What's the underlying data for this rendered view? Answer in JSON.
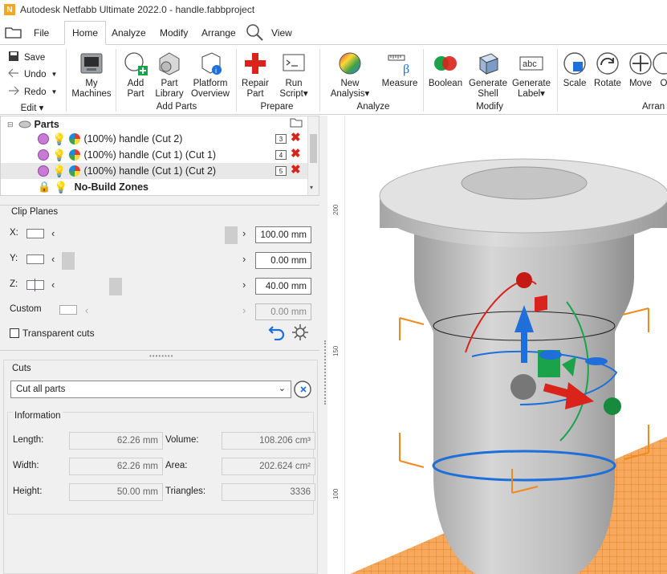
{
  "window": {
    "title": "Autodesk Netfabb Ultimate 2022.0 - handle.fabbproject",
    "app_icon": "N"
  },
  "tabs": [
    {
      "label": "File"
    },
    {
      "label": "Home"
    },
    {
      "label": "Analyze"
    },
    {
      "label": "Modify"
    },
    {
      "label": "Arrange"
    },
    {
      "label": "View"
    }
  ],
  "ribbon": {
    "edit": {
      "save": "Save",
      "undo": "Undo",
      "redo": "Redo",
      "group": "Edit"
    },
    "my_machines": [
      "My",
      "Machines"
    ],
    "add_parts": {
      "add_part": [
        "Add",
        "Part"
      ],
      "part_library": [
        "Part",
        "Library"
      ],
      "platform_overview": [
        "Platform",
        "Overview"
      ],
      "group": "Add Parts"
    },
    "prepare": {
      "repair_part": [
        "Repair",
        "Part"
      ],
      "run_script": [
        "Run",
        "Script"
      ],
      "group": "Prepare"
    },
    "analyze": {
      "new_analysis": [
        "New",
        "Analysis"
      ],
      "measure": "Measure",
      "group": "Analyze"
    },
    "modify": {
      "boolean": "Boolean",
      "generate_shell": [
        "Generate",
        "Shell"
      ],
      "generate_label": [
        "Generate",
        "Label"
      ],
      "group": "Modify"
    },
    "arrange": {
      "scale": "Scale",
      "rotate": "Rotate",
      "move": "Move",
      "more": "O",
      "group": "Arran"
    }
  },
  "tree": {
    "root": "Parts",
    "items": [
      {
        "label": "(100%) handle (Cut 2)",
        "badge": "3"
      },
      {
        "label": "(100%) handle (Cut 1) (Cut 1)",
        "badge": "4"
      },
      {
        "label": "(100%) handle (Cut 1) (Cut 2)",
        "badge": "5"
      }
    ],
    "no_build": "No-Build Zones"
  },
  "clip_planes": {
    "title": "Clip Planes",
    "x": {
      "label": "X:",
      "value": "100.00 mm"
    },
    "y": {
      "label": "Y:",
      "value": "0.00 mm"
    },
    "z": {
      "label": "Z:",
      "value": "40.00 mm"
    },
    "custom": {
      "label": "Custom",
      "value": "0.00 mm"
    },
    "transparent_label": "Transparent cuts"
  },
  "cuts": {
    "title": "Cuts",
    "selected": "Cut all parts"
  },
  "information": {
    "title": "Information",
    "length_label": "Length:",
    "length": "62.26 mm",
    "width_label": "Width:",
    "width": "62.26 mm",
    "height_label": "Height:",
    "height": "50.00 mm",
    "volume_label": "Volume:",
    "volume": "108.206 cm³",
    "area_label": "Area:",
    "area": "202.624 cm²",
    "triangles_label": "Triangles:",
    "triangles": "3336"
  },
  "viewport": {
    "ruler": [
      "200",
      "150",
      "100"
    ]
  },
  "colors": {
    "accent_red": "#d9231b",
    "gizmo_blue": "#1e6fd9",
    "gizmo_green": "#1aa34a",
    "grid_orange": "#f08a1a"
  }
}
